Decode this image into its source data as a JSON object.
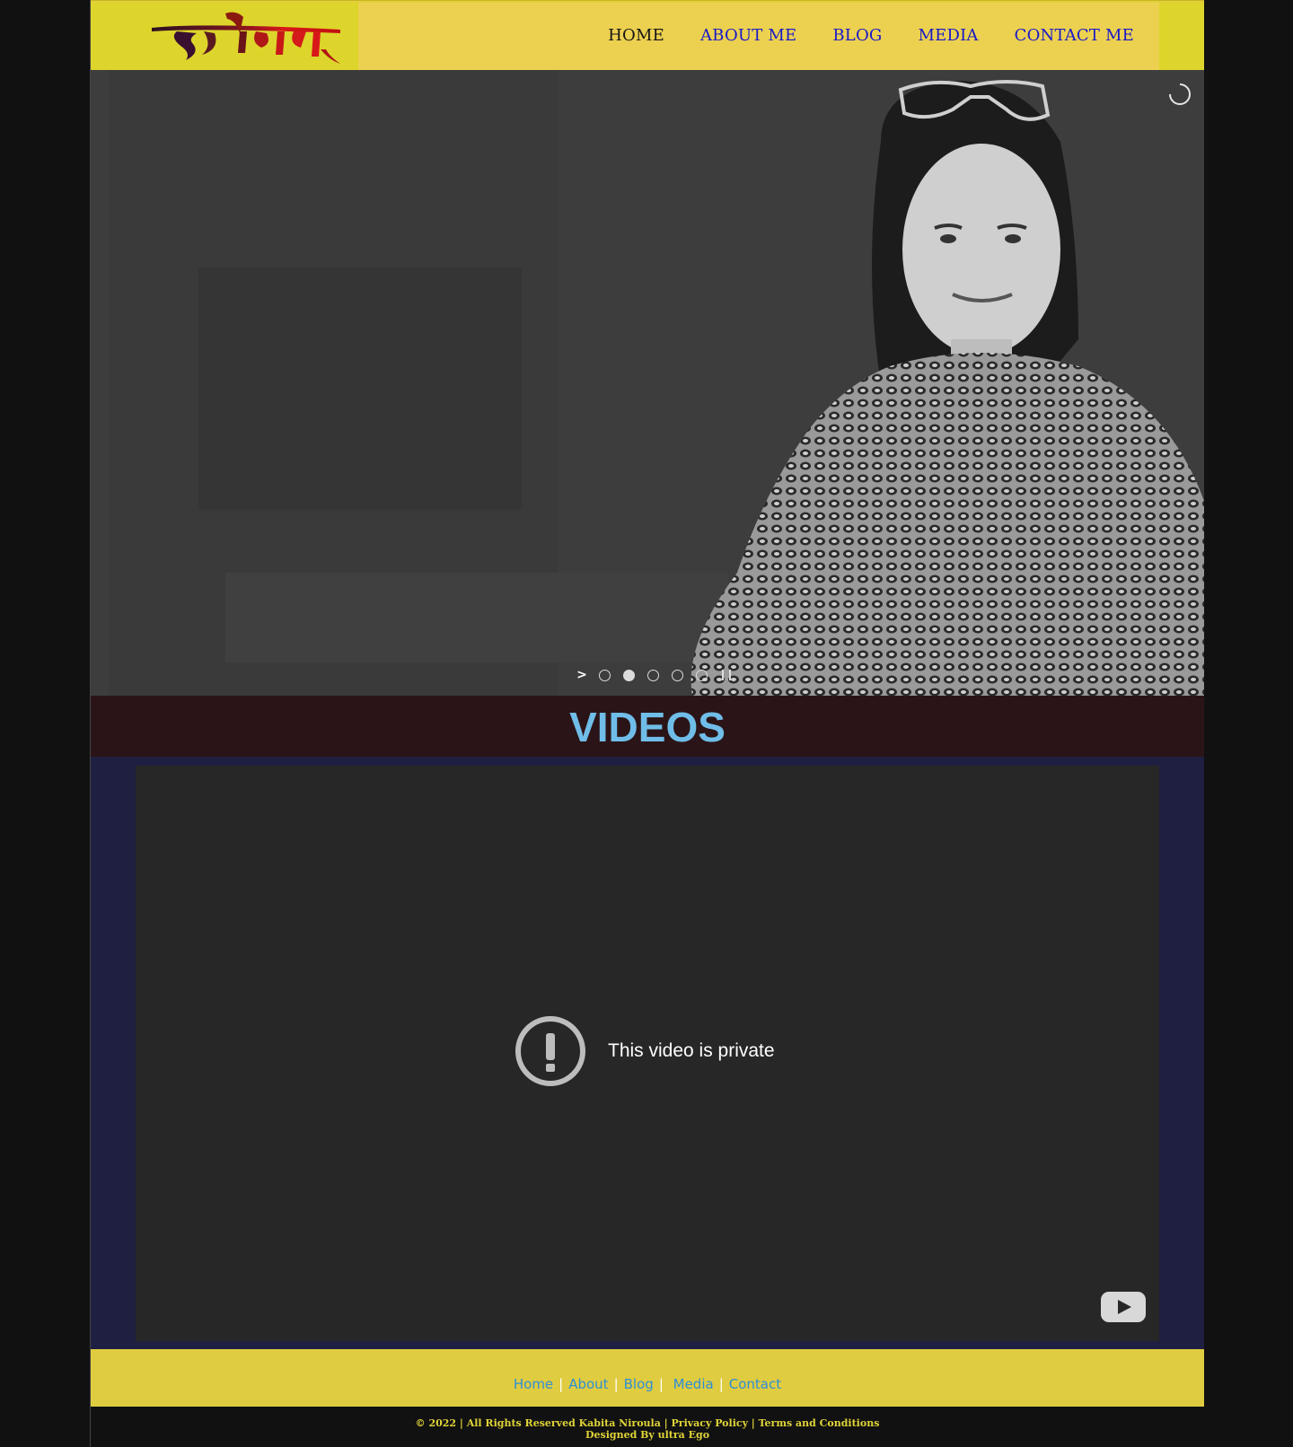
{
  "header": {
    "logo_text": "कविता",
    "nav": [
      {
        "label": "HOME"
      },
      {
        "label": "ABOUT ME"
      },
      {
        "label": "BLOG"
      },
      {
        "label": "MEDIA"
      },
      {
        "label": "CONTACT ME"
      }
    ],
    "active_index": 0
  },
  "hero": {
    "slider_icons": [
      "next-arrow-icon",
      "dot-icon",
      "pause-icon",
      "loading-spinner-icon"
    ],
    "slide_count": 5,
    "active_slide": 2
  },
  "videos": {
    "title": "VIDEOS",
    "player_message": "This video is private",
    "icons": [
      "warning-icon",
      "youtube-icon"
    ]
  },
  "footer": {
    "links": [
      "Home",
      "About",
      "Blog",
      "Media",
      "Contact"
    ],
    "copyright_line1": "© 2022 | All Rights Reserved Kabita Niroula | Privacy Policy | Terms and Conditions",
    "copyright_line2": "Designed By ultra Ego"
  },
  "colors": {
    "header_bg": "#e2cf3c",
    "nav_link": "#1919c8",
    "nav_active": "#151515",
    "videos_title": "#6fbde8",
    "videos_band": "#2b1417",
    "video_section_bg": "#1f1f42",
    "footer_link": "#2d8fd6",
    "copyright": "#e0d438"
  }
}
